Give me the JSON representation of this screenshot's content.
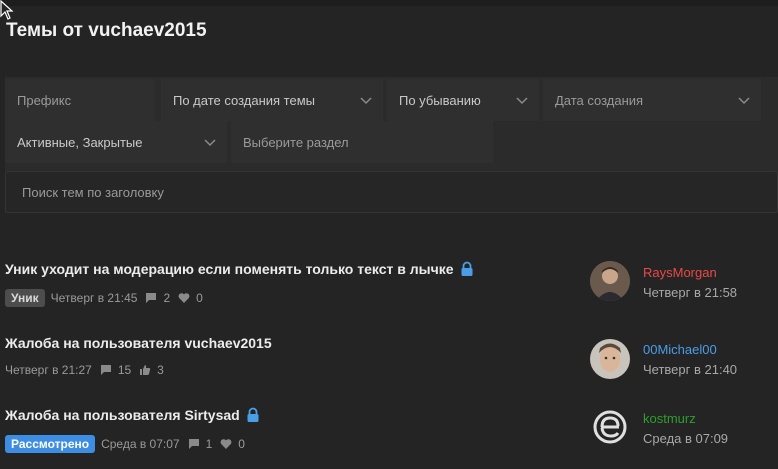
{
  "page": {
    "title": "Темы от vuchaev2015"
  },
  "filters": {
    "prefix": "Префикс",
    "order": "По дате создания темы",
    "direction": "По убыванию",
    "created": "Дата создания",
    "state": "Активные, Закрытые",
    "section": "Выберите раздел"
  },
  "search": {
    "placeholder": "Поиск тем по заголовку"
  },
  "threads": [
    {
      "title": "Уник уходит на модерацию если поменять только текст в лычке",
      "locked": true,
      "prefix": "Уник",
      "date": "Четверг в 21:45",
      "replies": "2",
      "reactions": "0",
      "last_user": "RaysMorgan",
      "last_user_color": "#e84a4a",
      "last_time": "Четверг в 21:58"
    },
    {
      "title": "Жалоба на пользователя vuchaev2015",
      "locked": false,
      "prefix": "",
      "date": "Четверг в 21:27",
      "replies": "15",
      "reactions": "3",
      "last_user": "00Michael00",
      "last_user_color": "#4a9ee8",
      "last_time": "Четверг в 21:40"
    },
    {
      "title": "Жалоба на пользователя Sirtysad",
      "locked": true,
      "prefix": "Рассмотрено",
      "date": "Среда в 07:07",
      "replies": "1",
      "reactions": "0",
      "last_user": "kostmurz",
      "last_user_color": "#2e9e2e",
      "last_time": "Среда в 07:09"
    }
  ],
  "colors": {
    "background": "#242424",
    "lock": "#4a9ee8",
    "prefix_grey": "#4d4d4d",
    "prefix_blue": "#3d8ee3"
  }
}
